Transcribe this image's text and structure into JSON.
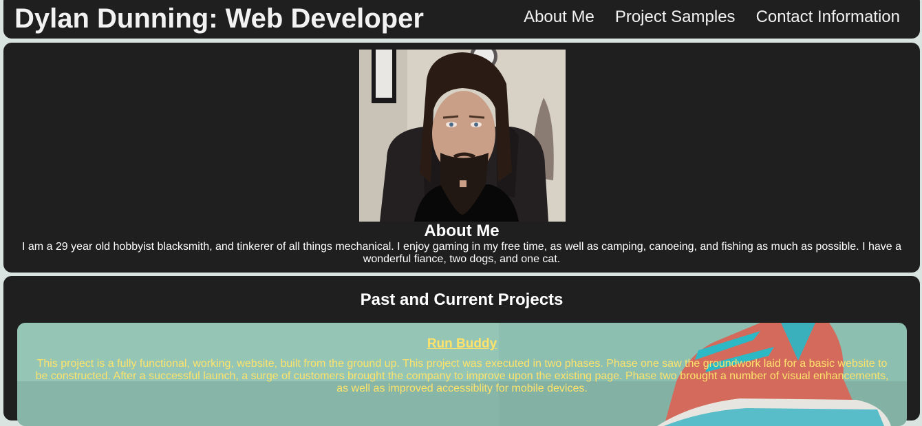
{
  "header": {
    "title": "Dylan Dunning: Web Developer",
    "nav": [
      "About Me",
      "Project Samples",
      "Contact Information"
    ]
  },
  "about": {
    "heading": "About Me",
    "text": "I am a 29 year old hobbyist blacksmith, and tinkerer of all things mechanical. I enjoy gaming in my free time, as well as camping, canoeing, and fishing as much as possible. I have a wonderful fiance, two dogs, and one cat."
  },
  "projects": {
    "heading": "Past and Current Projects",
    "items": [
      {
        "title": "Run Buddy",
        "description": "This project is a fully functional, working, website, built from the ground up. This project was executed in two phases. Phase one saw the groundwork laid for a basic website to be constructed. After a successful launch, a surge of customers brought the company to improve upon the existing page. Phase two brought a number of visual enhancements, as well as improved accessiblity for mobile devices."
      }
    ]
  },
  "colors": {
    "panel": "#201f1f",
    "page_background": "#d9e4e1",
    "project_text": "#ffe36b"
  }
}
